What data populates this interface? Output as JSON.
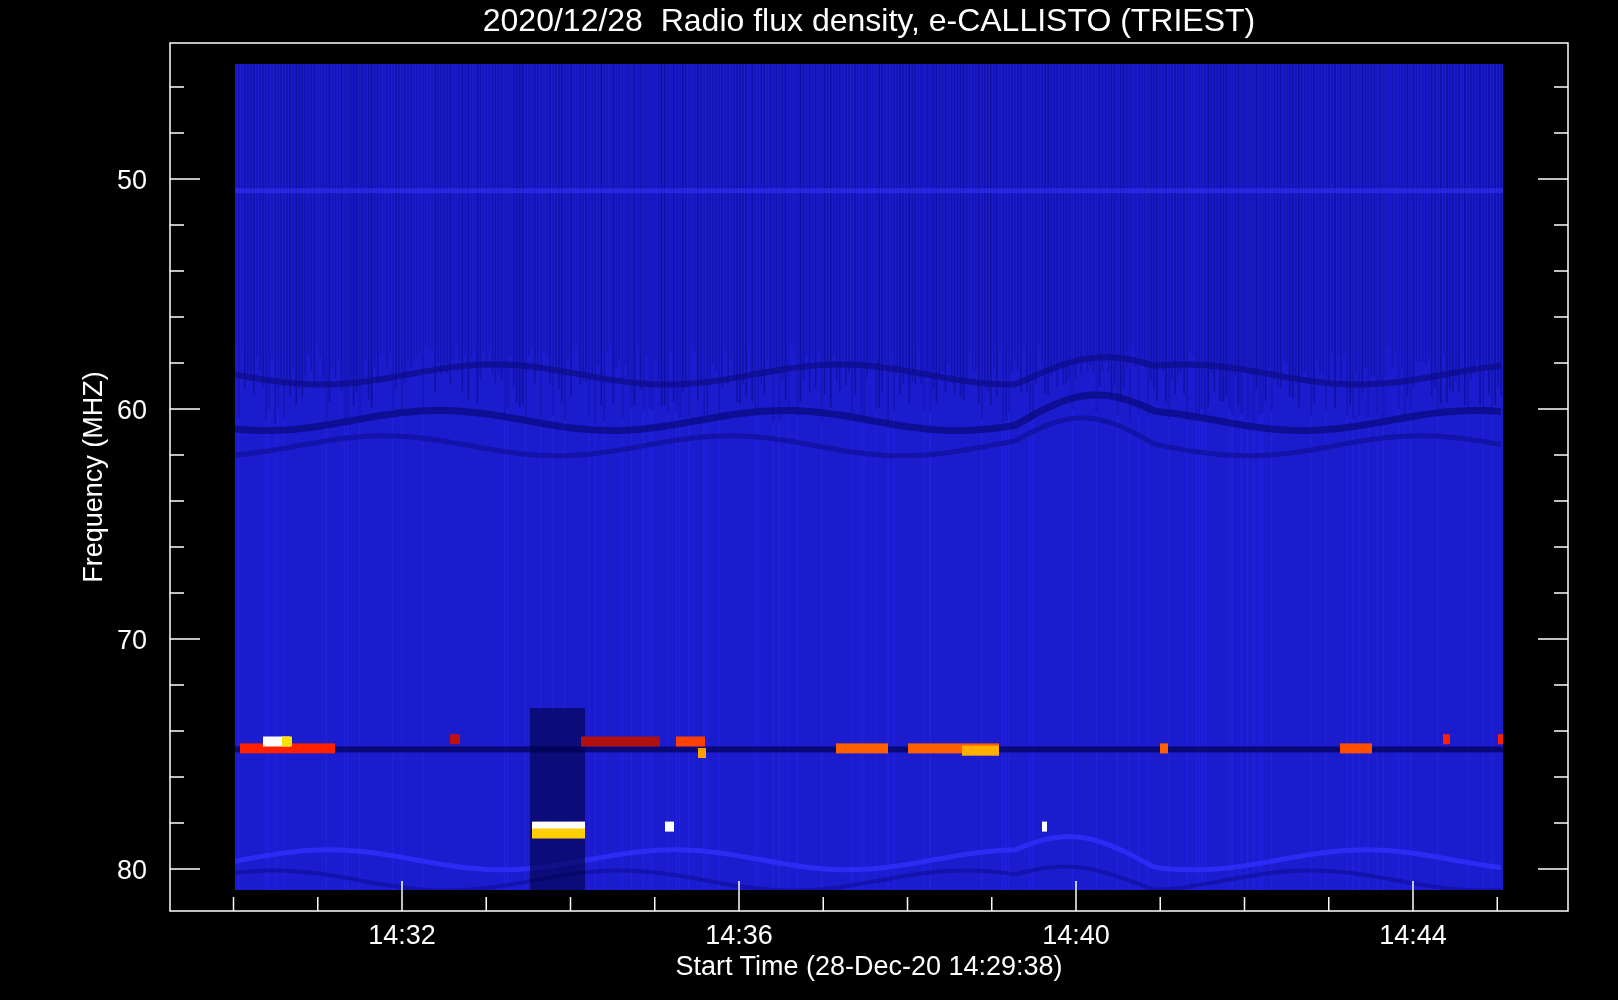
{
  "title": "2020/12/28  Radio flux density, e-CALLISTO (TRIEST)",
  "y_axis": {
    "label": "Frequency (MHZ)",
    "ticks": [
      "50",
      "60",
      "70",
      "80"
    ]
  },
  "x_axis": {
    "label": "Start Time (28-Dec-20 14:29:38)",
    "ticks": [
      "14:32",
      "14:36",
      "14:40",
      "14:44"
    ]
  }
}
